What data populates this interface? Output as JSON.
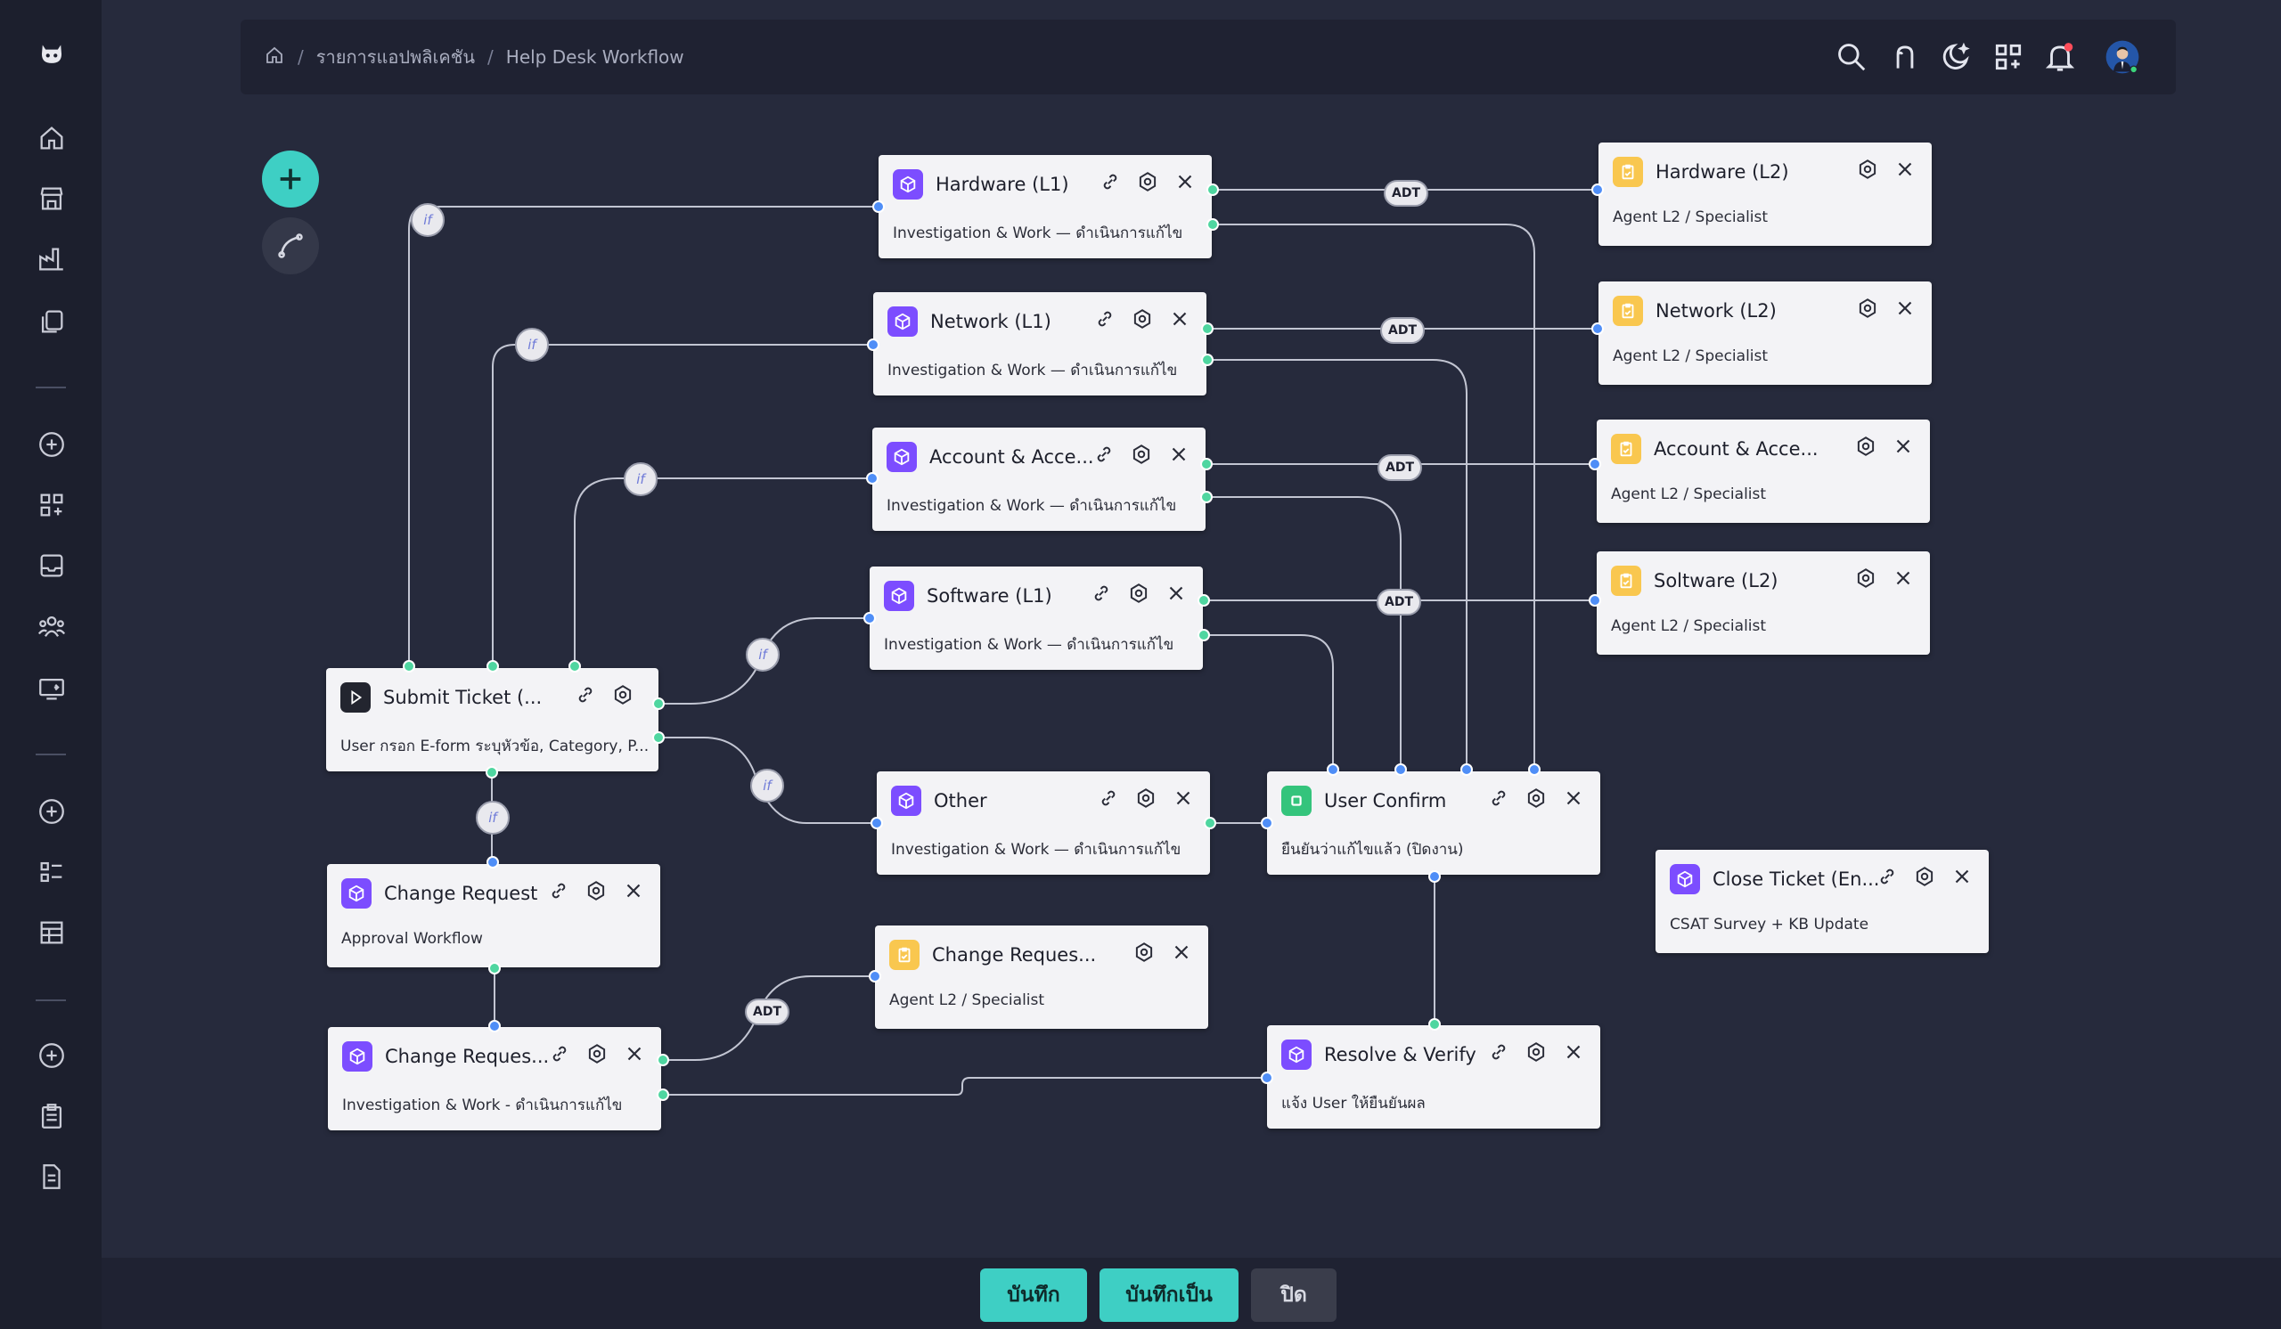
{
  "breadcrumb": {
    "items": [
      "รายการแอปพลิเคชัน",
      "Help Desk Workflow"
    ],
    "separator": "/"
  },
  "topbar_icons": [
    "search-icon",
    "translate-icon",
    "moon-icon",
    "apps-grid-icon",
    "bell-icon",
    "user-avatar"
  ],
  "sidebar_icons": [
    "logo-icon",
    "home-icon",
    "store-icon",
    "factory-icon",
    "copy-icon",
    "add-circle-icon",
    "apps-add-icon",
    "inbox-icon",
    "users-icon",
    "screen-share-icon",
    "add-circle-icon",
    "list-icon",
    "table-icon",
    "add-circle-icon",
    "clipboard-icon",
    "document-icon"
  ],
  "nodes": {
    "hardware_l1": {
      "title": "Hardware (L1)",
      "subtitle": "Investigation & Work — ดำเนินการแก้ไข"
    },
    "network_l1": {
      "title": "Network (L1)",
      "subtitle": "Investigation & Work — ดำเนินการแก้ไข"
    },
    "account_l1": {
      "title": "Account & Acce...",
      "subtitle": "Investigation & Work — ดำเนินการแก้ไข"
    },
    "software_l1": {
      "title": "Software (L1)",
      "subtitle": "Investigation & Work — ดำเนินการแก้ไข"
    },
    "other": {
      "title": "Other",
      "subtitle": "Investigation & Work — ดำเนินการแก้ไข"
    },
    "submit_ticket": {
      "title": "Submit Ticket (...",
      "subtitle": "User กรอก E-form ระบุหัวข้อ, Category, P..."
    },
    "change_request": {
      "title": "Change Request",
      "subtitle": "Approval Workflow"
    },
    "change_request_work": {
      "title": "Change Reques...",
      "subtitle": "Investigation & Work - ดำเนินการแก้ไข"
    },
    "change_request_l2": {
      "title": "Change Reques...",
      "subtitle": "Agent L2 / Specialist"
    },
    "user_confirm": {
      "title": "User Confirm",
      "subtitle": "ยืนยันว่าแก้ไขแล้ว (ปิดงาน)"
    },
    "resolve_verify": {
      "title": "Resolve & Verify",
      "subtitle": "แจ้ง User ให้ยืนยันผล"
    },
    "close_ticket": {
      "title": "Close Ticket (En...",
      "subtitle": "CSAT Survey + KB Update"
    },
    "hardware_l2": {
      "title": "Hardware (L2)",
      "subtitle": "Agent L2 / Specialist"
    },
    "network_l2": {
      "title": "Network (L2)",
      "subtitle": "Agent L2 / Specialist"
    },
    "account_l2": {
      "title": "Account & Acce...",
      "subtitle": "Agent L2 / Specialist"
    },
    "software_l2": {
      "title": "Soltware (L2)",
      "subtitle": "Agent L2 / Specialist"
    }
  },
  "badges": {
    "if": "if",
    "adt": "ADT"
  },
  "footer": {
    "save": "บันทึก",
    "save_as": "บันทึกเป็น",
    "close": "ปิด"
  },
  "colors": {
    "background": "#262a3c",
    "accent": "#3ecfc4",
    "node_purple": "#7c4dff",
    "node_yellow": "#f9c74f",
    "node_green": "#34c47c",
    "port_green": "#4fd6a0",
    "port_blue": "#4f8ef7"
  }
}
